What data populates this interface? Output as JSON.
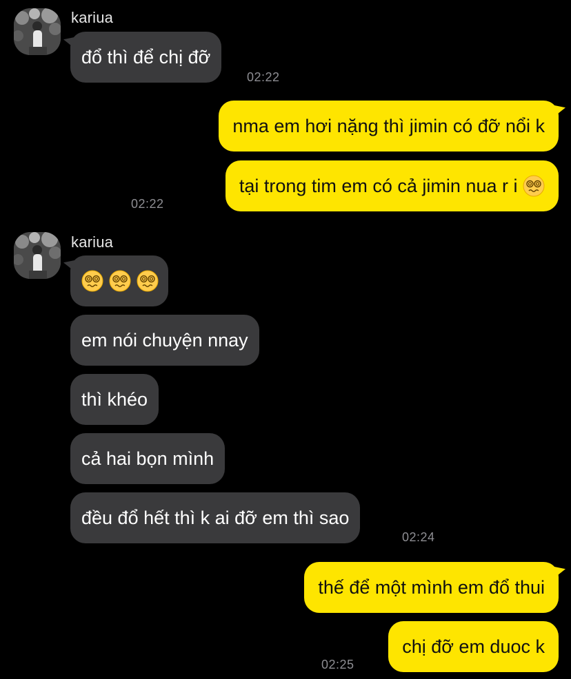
{
  "chat": {
    "group1": {
      "sender": "kariua",
      "messages": [
        "đổ thì để chị đỡ"
      ],
      "time": "02:22"
    },
    "group2": {
      "messages": [
        "nma em hơi nặng thì jimin có đỡ nổi k",
        "tại trong tim em có cả jimin nua r i"
      ],
      "emoji": "woozy-face-emoji",
      "time": "02:22"
    },
    "group3": {
      "sender": "kariua",
      "emoji_count": 3,
      "emoji": "woozy-face-emoji",
      "messages": [
        "em nói chuyện nnay",
        "thì khéo",
        "cả hai bọn mình",
        "đều đổ hết thì k ai đỡ em thì sao"
      ],
      "time": "02:24"
    },
    "group4": {
      "messages": [
        "thế để một mình em đổ thui",
        "chị đỡ em duoc k"
      ],
      "time": "02:25"
    }
  },
  "colors": {
    "background": "#000000",
    "incoming_bubble": "#3a3a3c",
    "outgoing_bubble": "#fee500",
    "timestamp": "#8e8e93"
  }
}
